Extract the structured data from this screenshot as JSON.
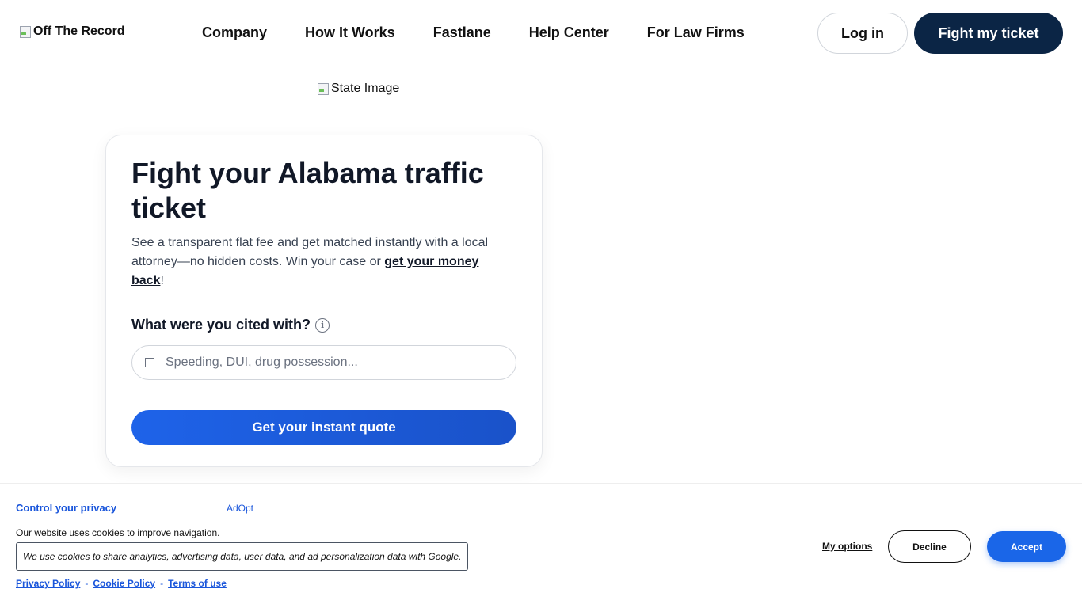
{
  "header": {
    "logo_alt": "Off The Record",
    "nav": [
      {
        "label": "Company"
      },
      {
        "label": "How It Works"
      },
      {
        "label": "Fastlane"
      },
      {
        "label": "Help Center"
      },
      {
        "label": "For Law Firms"
      }
    ],
    "login_label": "Log in",
    "cta_label": "Fight my ticket"
  },
  "state_image_alt": "State Image",
  "card": {
    "title": "Fight your Alabama traffic ticket",
    "description_prefix": "See a transparent flat fee and get matched instantly with a local attorney—no hidden costs. Win your case or ",
    "description_link": "get your money back",
    "description_suffix": "!",
    "cited_label": "What were you cited with?",
    "info_icon": "info-icon",
    "search_placeholder": "Speeding, DUI, drug possession...",
    "search_value": "",
    "quote_button": "Get your instant quote"
  },
  "cookie": {
    "title": "Control your privacy",
    "brand": "AdOpt",
    "text": "Our website uses cookies to improve navigation.",
    "box_text": "We use cookies to share analytics, advertising data, user data, and ad personalization data with Google.",
    "links": {
      "privacy": "Privacy Policy",
      "cookie": "Cookie Policy",
      "terms": "Terms of use",
      "separator": "-"
    },
    "my_options": "My options",
    "decline": "Decline",
    "accept": "Accept"
  },
  "colors": {
    "navy": "#0b2545",
    "primary_blue": "#1e63e9",
    "link_blue": "#1a56db"
  }
}
